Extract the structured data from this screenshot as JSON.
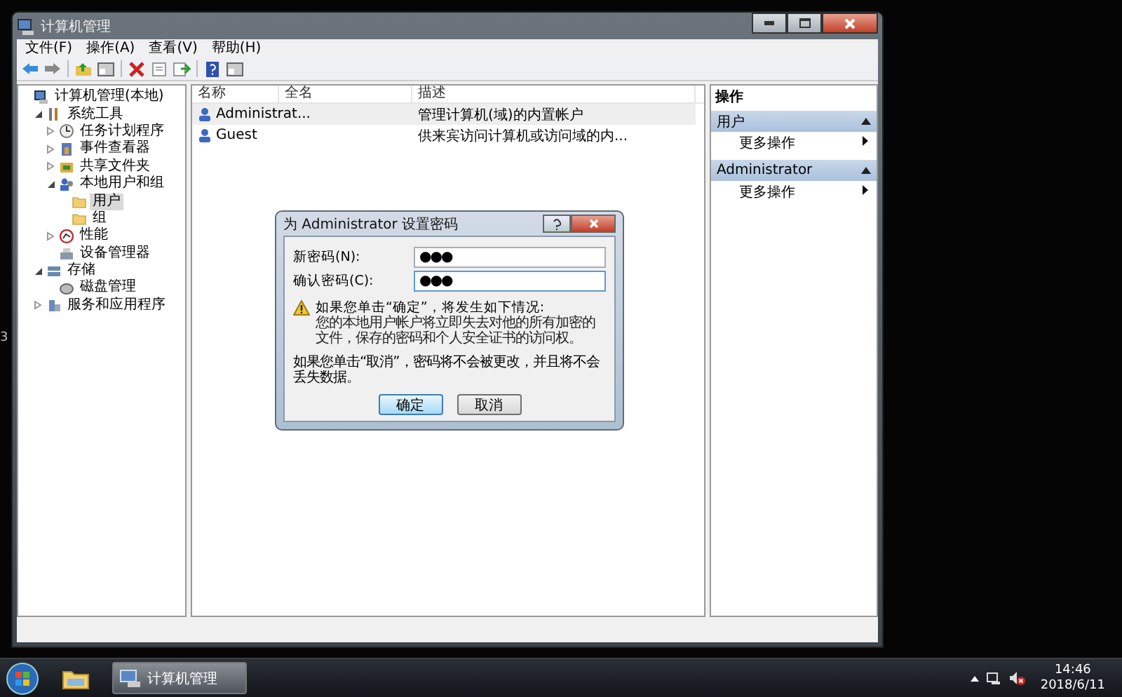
{
  "desktop_text": "3",
  "window": {
    "title": "计算机管理"
  },
  "menu": [
    "文件(F)",
    "操作(A)",
    "查看(V)",
    "帮助(H)"
  ],
  "tree": [
    {
      "label": "计算机管理(本地)",
      "selected": false,
      "children": [
        {
          "label": "系统工具",
          "selected": false,
          "expanded": true,
          "children": [
            {
              "label": "任务计划程序",
              "selected": false,
              "expanded": false
            },
            {
              "label": "事件查看器",
              "selected": false,
              "expanded": false
            },
            {
              "label": "共享文件夹",
              "selected": false,
              "expanded": false
            },
            {
              "label": "本地用户和组",
              "selected": false,
              "expanded": true,
              "children": [
                {
                  "label": "用户",
                  "selected": true
                },
                {
                  "label": "组",
                  "selected": false
                }
              ]
            },
            {
              "label": "性能",
              "selected": false,
              "expanded": false
            },
            {
              "label": "设备管理器",
              "selected": false
            }
          ]
        },
        {
          "label": "存储",
          "selected": false,
          "expanded": true,
          "children": [
            {
              "label": "磁盘管理",
              "selected": false
            }
          ]
        },
        {
          "label": "服务和应用程序",
          "selected": false,
          "expanded": false
        }
      ]
    }
  ],
  "table": {
    "columns": [
      "名称",
      "全名",
      "描述"
    ],
    "rows": [
      {
        "cells": [
          "Administrat...",
          "",
          "管理计算机(域)的内置帐户"
        ],
        "selected": true
      },
      {
        "cells": [
          "Guest",
          "",
          "供来宾访问计算机或访问域的内..."
        ],
        "selected": false
      }
    ]
  },
  "actions": {
    "title": "操作",
    "sections": [
      {
        "title": "用户",
        "expanded": true,
        "items": [
          "更多操作"
        ]
      },
      {
        "title": "Administrator",
        "expanded": true,
        "items": [
          "更多操作"
        ]
      }
    ]
  },
  "dialog": {
    "title": "为 Administrator 设置密码",
    "fields": [
      {
        "label": "新密码(N):",
        "value": "●●●",
        "focused": false
      },
      {
        "label": "确认密码(C):",
        "value": "●●●",
        "focused": true
      }
    ],
    "warning": "如果您单击“确定”，将发生如下情况:",
    "warning_detail": "您的本地用户帐户将立即失去对他的所有加密的文件，保存的密码和个人安全证书的访问权。",
    "note": "如果您单击“取消”，密码将不会被更改，并且将不会丢失数据。",
    "buttons": [
      {
        "label": "确定",
        "selected": true
      },
      {
        "label": "取消",
        "selected": false
      }
    ]
  },
  "taskbar": {
    "tasks": [
      {
        "label": "计算机管理",
        "selected": true
      }
    ],
    "time": "14:46",
    "date": "2018/6/11"
  }
}
